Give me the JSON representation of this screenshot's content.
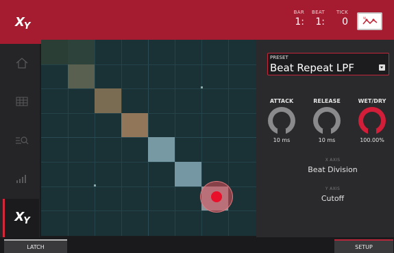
{
  "header": {
    "logo": {
      "main": "X",
      "sub": "Y"
    },
    "counters": [
      {
        "label": "BAR",
        "value": "1:"
      },
      {
        "label": "BEAT",
        "value": "1:"
      },
      {
        "label": "TICK",
        "value": "0"
      }
    ],
    "automation_icon": "automation-curve-icon"
  },
  "sidebar": {
    "items": [
      {
        "icon": "home-icon",
        "active": false
      },
      {
        "icon": "grid-icon",
        "active": false
      },
      {
        "icon": "search-settings-icon",
        "active": false
      },
      {
        "icon": "level-bars-icon",
        "active": false
      },
      {
        "icon": "xy-icon",
        "active": true,
        "main": "X",
        "sub": "Y"
      }
    ]
  },
  "pad": {
    "rows": 8,
    "cols": 8,
    "highlight_colors": [
      "#39463a",
      "#6c6c5a",
      "#8a7458",
      "#9c7d60",
      "#7f9fa8",
      "#7d9ba7",
      "#8d9aa0"
    ],
    "touch_color": "#e8102a"
  },
  "panel": {
    "preset_label": "PRESET",
    "preset_value": "Beat Repeat LPF",
    "knobs": [
      {
        "label": "ATTACK",
        "value": "10 ms",
        "color": "#8a8a8c"
      },
      {
        "label": "RELEASE",
        "value": "10 ms",
        "color": "#8a8a8c"
      },
      {
        "label": "WET/DRY",
        "value": "100.00%",
        "color": "#d21e38"
      }
    ],
    "x_axis_label": "X AXIS",
    "x_axis_value": "Beat Division",
    "y_axis_label": "Y AXIS",
    "y_axis_value": "Cutoff"
  },
  "footer": {
    "latch_label": "LATCH",
    "setup_label": "SETUP"
  },
  "colors": {
    "accent": "#a51c30",
    "pad_bg": "#1a3236"
  }
}
